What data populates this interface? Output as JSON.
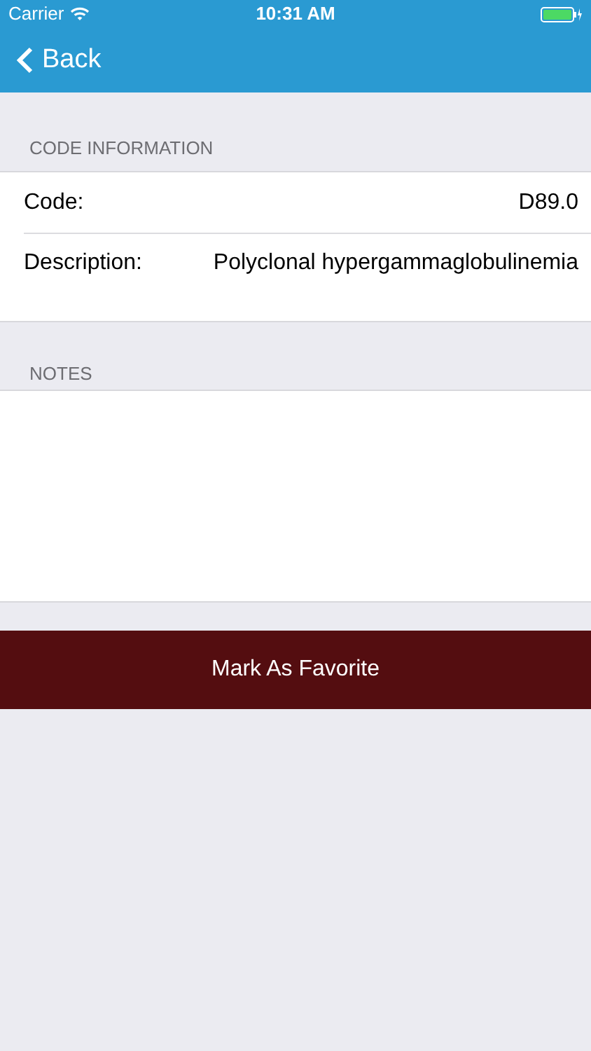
{
  "status_bar": {
    "carrier": "Carrier",
    "time": "10:31 AM"
  },
  "nav_bar": {
    "back": "Back"
  },
  "code_information": {
    "header": "CODE INFORMATION",
    "rows": [
      {
        "label": "Code:",
        "value": "D89.0"
      },
      {
        "label": "Description:",
        "value": "Polyclonal hypergammaglobulinemia"
      }
    ]
  },
  "notes": {
    "header": "NOTES"
  },
  "favorite_button": "Mark As Favorite"
}
